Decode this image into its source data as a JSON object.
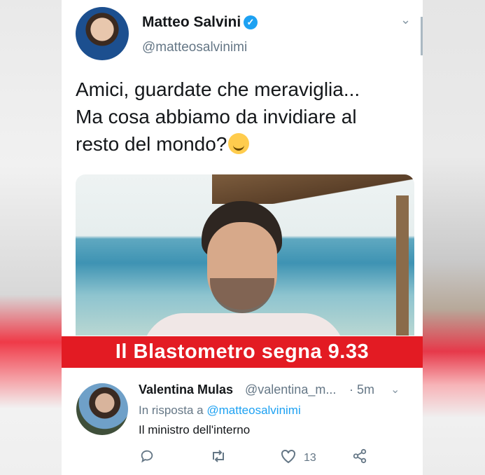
{
  "tweet": {
    "author_name": "Matteo Salvini",
    "verified_icon": "verified-badge-icon",
    "author_handle": "@matteosalvinimi",
    "text_line1": "Amici, guardate che meraviglia...",
    "text_line2": "Ma cosa abbiamo da invidiare al",
    "text_line3": "resto del mondo?",
    "emoji": "smiling-face-emoji"
  },
  "banner": {
    "text": "Il Blastometro segna 9.33",
    "color": "#e31b23"
  },
  "reply": {
    "author_name": "Valentina Mulas",
    "author_handle": "@valentina_m...",
    "time": "· 5m",
    "in_reply_label": "In risposta a",
    "in_reply_mention": "@matteosalvinimi",
    "text": "Il ministro dell'interno",
    "like_count": "13"
  },
  "colors": {
    "accent": "#1da1f2",
    "muted": "#657786"
  }
}
